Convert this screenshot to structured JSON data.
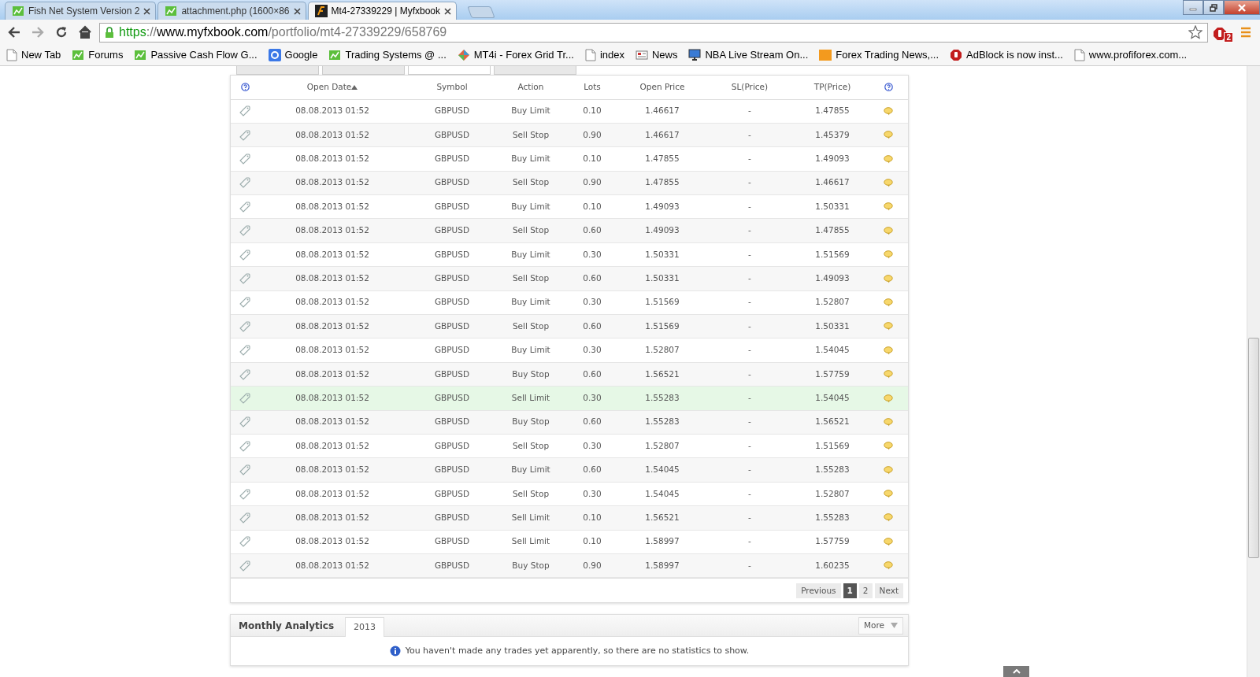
{
  "browser": {
    "tabs": [
      {
        "title": "Fish Net System Version 2",
        "kind": "chart",
        "selected": false
      },
      {
        "title": "attachment.php (1600×86",
        "kind": "chart",
        "selected": false
      },
      {
        "title": "Mt4-27339229 | Myfxbook",
        "kind": "fx",
        "selected": true
      }
    ],
    "url": [
      {
        "text": "https",
        "color": "#129a12"
      },
      {
        "text": "://",
        "color": "#777777"
      },
      {
        "text": "www.myfxbook.com",
        "color": "#000000"
      },
      {
        "text": "/portfolio/mt4-27339229/658769",
        "color": "#777777"
      }
    ],
    "adblock_count": "2",
    "bookmarks": [
      {
        "label": "New Tab",
        "kind": "page"
      },
      {
        "label": "Forums",
        "kind": "chart"
      },
      {
        "label": "Passive Cash Flow G...",
        "kind": "chart"
      },
      {
        "label": "Google",
        "kind": "google"
      },
      {
        "label": "Trading Systems @ ...",
        "kind": "chart"
      },
      {
        "label": "MT4i - Forex Grid Tr...",
        "kind": "colorful"
      },
      {
        "label": "index",
        "kind": "page"
      },
      {
        "label": "News",
        "kind": "news"
      },
      {
        "label": "NBA Live Stream On...",
        "kind": "monitor"
      },
      {
        "label": "Forex Trading News,...",
        "kind": "orange"
      },
      {
        "label": "AdBlock is now inst...",
        "kind": "stop"
      },
      {
        "label": "www.profiforex.com...",
        "kind": "page"
      }
    ]
  },
  "orders": {
    "columns": [
      {
        "label": "Open Date",
        "sorted": true
      },
      {
        "label": "Symbol",
        "sorted": false
      },
      {
        "label": "Action",
        "sorted": false
      },
      {
        "label": "Lots",
        "sorted": false
      },
      {
        "label": "Open Price",
        "sorted": false
      },
      {
        "label": "SL(Price)",
        "sorted": false
      },
      {
        "label": "TP(Price)",
        "sorted": false
      }
    ],
    "rows": [
      {
        "date": "08.08.2013 01:52",
        "symbol": "GBPUSD",
        "action": "Buy Limit",
        "lots": "0.10",
        "open_price": "1.46617",
        "sl": "-",
        "tp": "1.47855",
        "highlighted": false
      },
      {
        "date": "08.08.2013 01:52",
        "symbol": "GBPUSD",
        "action": "Sell Stop",
        "lots": "0.90",
        "open_price": "1.46617",
        "sl": "-",
        "tp": "1.45379",
        "highlighted": false
      },
      {
        "date": "08.08.2013 01:52",
        "symbol": "GBPUSD",
        "action": "Buy Limit",
        "lots": "0.10",
        "open_price": "1.47855",
        "sl": "-",
        "tp": "1.49093",
        "highlighted": false
      },
      {
        "date": "08.08.2013 01:52",
        "symbol": "GBPUSD",
        "action": "Sell Stop",
        "lots": "0.90",
        "open_price": "1.47855",
        "sl": "-",
        "tp": "1.46617",
        "highlighted": false
      },
      {
        "date": "08.08.2013 01:52",
        "symbol": "GBPUSD",
        "action": "Buy Limit",
        "lots": "0.10",
        "open_price": "1.49093",
        "sl": "-",
        "tp": "1.50331",
        "highlighted": false
      },
      {
        "date": "08.08.2013 01:52",
        "symbol": "GBPUSD",
        "action": "Sell Stop",
        "lots": "0.60",
        "open_price": "1.49093",
        "sl": "-",
        "tp": "1.47855",
        "highlighted": false
      },
      {
        "date": "08.08.2013 01:52",
        "symbol": "GBPUSD",
        "action": "Buy Limit",
        "lots": "0.30",
        "open_price": "1.50331",
        "sl": "-",
        "tp": "1.51569",
        "highlighted": false
      },
      {
        "date": "08.08.2013 01:52",
        "symbol": "GBPUSD",
        "action": "Sell Stop",
        "lots": "0.60",
        "open_price": "1.50331",
        "sl": "-",
        "tp": "1.49093",
        "highlighted": false
      },
      {
        "date": "08.08.2013 01:52",
        "symbol": "GBPUSD",
        "action": "Buy Limit",
        "lots": "0.30",
        "open_price": "1.51569",
        "sl": "-",
        "tp": "1.52807",
        "highlighted": false
      },
      {
        "date": "08.08.2013 01:52",
        "symbol": "GBPUSD",
        "action": "Sell Stop",
        "lots": "0.60",
        "open_price": "1.51569",
        "sl": "-",
        "tp": "1.50331",
        "highlighted": false
      },
      {
        "date": "08.08.2013 01:52",
        "symbol": "GBPUSD",
        "action": "Buy Limit",
        "lots": "0.30",
        "open_price": "1.52807",
        "sl": "-",
        "tp": "1.54045",
        "highlighted": false
      },
      {
        "date": "08.08.2013 01:52",
        "symbol": "GBPUSD",
        "action": "Buy Stop",
        "lots": "0.60",
        "open_price": "1.56521",
        "sl": "-",
        "tp": "1.57759",
        "highlighted": false
      },
      {
        "date": "08.08.2013 01:52",
        "symbol": "GBPUSD",
        "action": "Sell Limit",
        "lots": "0.30",
        "open_price": "1.55283",
        "sl": "-",
        "tp": "1.54045",
        "highlighted": true
      },
      {
        "date": "08.08.2013 01:52",
        "symbol": "GBPUSD",
        "action": "Buy Stop",
        "lots": "0.60",
        "open_price": "1.55283",
        "sl": "-",
        "tp": "1.56521",
        "highlighted": false
      },
      {
        "date": "08.08.2013 01:52",
        "symbol": "GBPUSD",
        "action": "Sell Stop",
        "lots": "0.30",
        "open_price": "1.52807",
        "sl": "-",
        "tp": "1.51569",
        "highlighted": false
      },
      {
        "date": "08.08.2013 01:52",
        "symbol": "GBPUSD",
        "action": "Buy Limit",
        "lots": "0.60",
        "open_price": "1.54045",
        "sl": "-",
        "tp": "1.55283",
        "highlighted": false
      },
      {
        "date": "08.08.2013 01:52",
        "symbol": "GBPUSD",
        "action": "Sell Stop",
        "lots": "0.30",
        "open_price": "1.54045",
        "sl": "-",
        "tp": "1.52807",
        "highlighted": false
      },
      {
        "date": "08.08.2013 01:52",
        "symbol": "GBPUSD",
        "action": "Sell Limit",
        "lots": "0.10",
        "open_price": "1.56521",
        "sl": "-",
        "tp": "1.55283",
        "highlighted": false
      },
      {
        "date": "08.08.2013 01:52",
        "symbol": "GBPUSD",
        "action": "Sell Limit",
        "lots": "0.10",
        "open_price": "1.58997",
        "sl": "-",
        "tp": "1.57759",
        "highlighted": false
      },
      {
        "date": "08.08.2013 01:52",
        "symbol": "GBPUSD",
        "action": "Buy Stop",
        "lots": "0.90",
        "open_price": "1.58997",
        "sl": "-",
        "tp": "1.60235",
        "highlighted": false
      }
    ],
    "pagination": [
      {
        "label": "Previous",
        "kind": "nav",
        "selected": false
      },
      {
        "label": "1",
        "kind": "page",
        "selected": true
      },
      {
        "label": "2",
        "kind": "page",
        "selected": false
      },
      {
        "label": "Next",
        "kind": "nav",
        "selected": false
      }
    ]
  },
  "monthly": {
    "title": "Monthly Analytics",
    "tabs": [
      {
        "label": "2013",
        "selected": true
      }
    ],
    "more": "More",
    "message": "You haven't made any trades yet apparently, so there are no statistics to show."
  }
}
